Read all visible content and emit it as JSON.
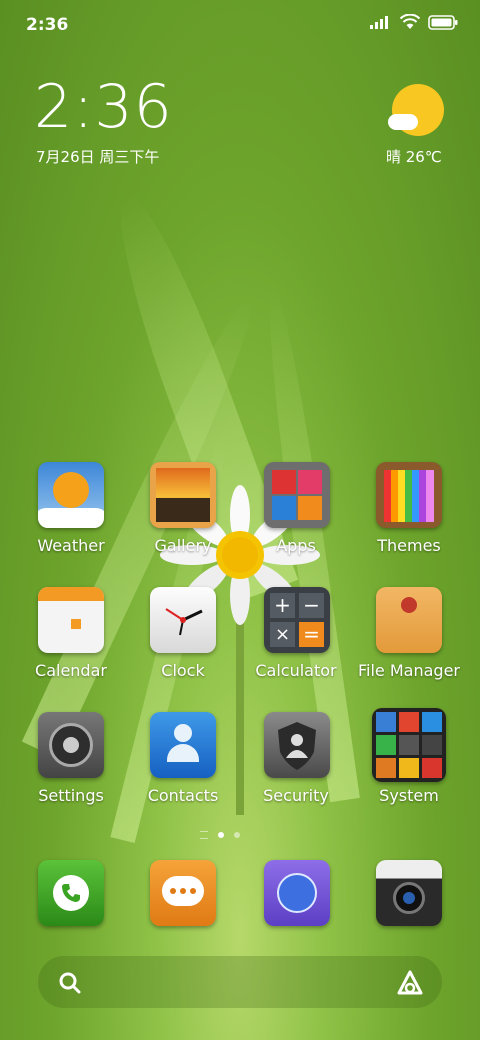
{
  "status_bar": {
    "time": "2:36"
  },
  "clock_widget": {
    "time": "2:36",
    "date": "7月26日 周三下午"
  },
  "weather_widget": {
    "text": "晴 26℃"
  },
  "apps": [
    {
      "label": "Weather",
      "icon": "weather-icon"
    },
    {
      "label": "Gallery",
      "icon": "gallery-icon"
    },
    {
      "label": "Apps",
      "icon": "apps-icon"
    },
    {
      "label": "Themes",
      "icon": "themes-icon"
    },
    {
      "label": "Calendar",
      "icon": "calendar-icon"
    },
    {
      "label": "Clock",
      "icon": "clock-icon"
    },
    {
      "label": "Calculator",
      "icon": "calculator-icon"
    },
    {
      "label": "File Manager",
      "icon": "file-manager-icon"
    },
    {
      "label": "Settings",
      "icon": "settings-icon"
    },
    {
      "label": "Contacts",
      "icon": "contacts-icon"
    },
    {
      "label": "Security",
      "icon": "security-icon"
    },
    {
      "label": "System",
      "icon": "system-icon"
    }
  ],
  "dock": [
    {
      "icon": "phone-icon"
    },
    {
      "icon": "messages-icon"
    },
    {
      "icon": "browser-icon"
    },
    {
      "icon": "camera-icon"
    }
  ],
  "page_indicator": {
    "pages": 2,
    "active": 0
  },
  "colors": {
    "sun": "#f8c722",
    "wallpaper": "#6ea52c"
  }
}
